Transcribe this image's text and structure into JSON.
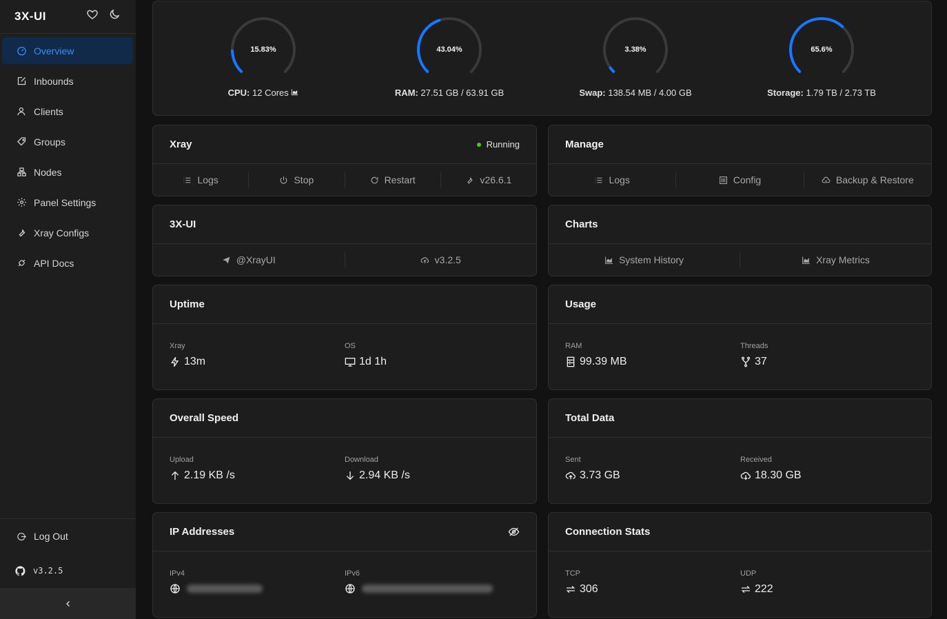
{
  "app": {
    "title": "3X-UI",
    "heart_icon": "heart-icon",
    "theme_icon": "moon-icon"
  },
  "sidebar": {
    "items": [
      {
        "label": "Overview",
        "icon": "dashboard-icon"
      },
      {
        "label": "Inbounds",
        "icon": "edit-icon"
      },
      {
        "label": "Clients",
        "icon": "user-icon"
      },
      {
        "label": "Groups",
        "icon": "tag-icon"
      },
      {
        "label": "Nodes",
        "icon": "cluster-icon"
      },
      {
        "label": "Panel Settings",
        "icon": "gear-icon"
      },
      {
        "label": "Xray Configs",
        "icon": "tool-icon"
      },
      {
        "label": "API Docs",
        "icon": "api-icon"
      }
    ],
    "logout": "Log Out",
    "version": "v3.2.5"
  },
  "gauges": [
    {
      "percent": "15.83%",
      "value": 15.83,
      "label_key": "CPU:",
      "label_value": "12 Cores"
    },
    {
      "percent": "43.04%",
      "value": 43.04,
      "label_key": "RAM:",
      "label_value": "27.51 GB / 63.91 GB"
    },
    {
      "percent": "3.38%",
      "value": 3.38,
      "label_key": "Swap:",
      "label_value": "138.54 MB / 4.00 GB"
    },
    {
      "percent": "65.6%",
      "value": 65.6,
      "label_key": "Storage:",
      "label_value": "1.79 TB / 2.73 TB"
    }
  ],
  "xray": {
    "title": "Xray",
    "status": "Running",
    "status_color": "#52c41a",
    "actions": [
      "Logs",
      "Stop",
      "Restart",
      "v26.6.1"
    ]
  },
  "manage": {
    "title": "Manage",
    "actions": [
      "Logs",
      "Config",
      "Backup & Restore"
    ]
  },
  "panel": {
    "title": "3X-UI",
    "actions": [
      "@XrayUI",
      "v3.2.5"
    ]
  },
  "charts": {
    "title": "Charts",
    "actions": [
      "System History",
      "Xray Metrics"
    ]
  },
  "uptime": {
    "title": "Uptime",
    "xray_label": "Xray",
    "xray_value": "13m",
    "os_label": "OS",
    "os_value": "1d 1h"
  },
  "usage": {
    "title": "Usage",
    "ram_label": "RAM",
    "ram_value": "99.39 MB",
    "threads_label": "Threads",
    "threads_value": "37"
  },
  "speed": {
    "title": "Overall Speed",
    "upload_label": "Upload",
    "upload_value": "2.19 KB /s",
    "download_label": "Download",
    "download_value": "2.94 KB /s"
  },
  "total": {
    "title": "Total Data",
    "sent_label": "Sent",
    "sent_value": "3.73 GB",
    "received_label": "Received",
    "received_value": "18.30 GB"
  },
  "ip": {
    "title": "IP Addresses",
    "ipv4_label": "IPv4",
    "ipv6_label": "IPv6"
  },
  "conn": {
    "title": "Connection Stats",
    "tcp_label": "TCP",
    "tcp_value": "306",
    "udp_label": "UDP",
    "udp_value": "222"
  },
  "colors": {
    "accent": "#1677ff",
    "track": "#3a3a3a",
    "active_bg": "#112a4a"
  }
}
